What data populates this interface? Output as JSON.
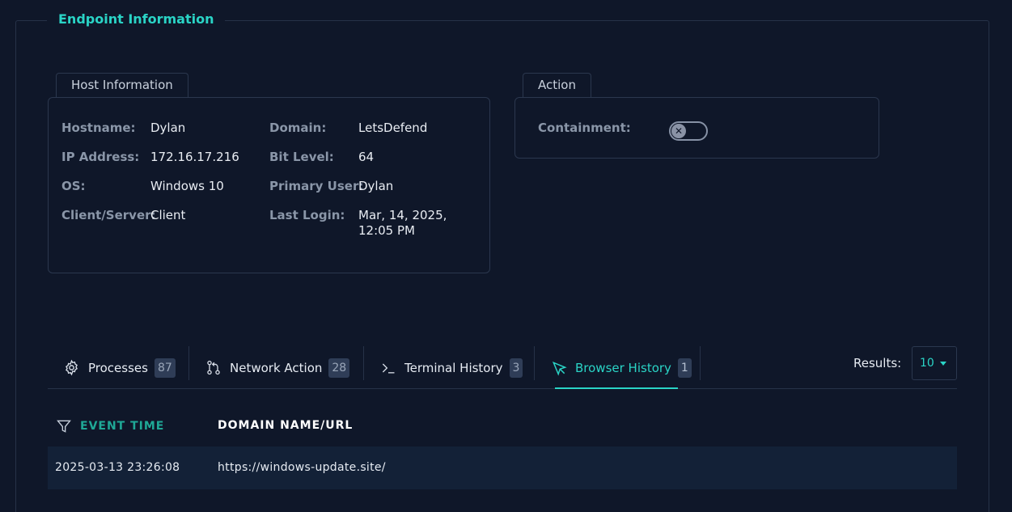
{
  "section": {
    "title": "Endpoint Information"
  },
  "host_panel": {
    "tab_label": "Host Information",
    "fields": [
      {
        "key": "Hostname:",
        "value": "Dylan"
      },
      {
        "key": "IP Address:",
        "value": "172.16.17.216"
      },
      {
        "key": "OS:",
        "value": "Windows 10"
      },
      {
        "key": "Client/Server:",
        "value": "Client"
      },
      {
        "key": "Domain:",
        "value": "LetsDefend"
      },
      {
        "key": "Bit Level:",
        "value": "64"
      },
      {
        "key": "Primary User:",
        "value": "Dylan"
      },
      {
        "key": "Last Login:",
        "value": "Mar, 14, 2025, 12:05 PM"
      }
    ]
  },
  "action_panel": {
    "tab_label": "Action",
    "containment_label": "Containment:",
    "containment_enabled": false,
    "knob_glyph": "✕"
  },
  "tabs": [
    {
      "label": "Processes",
      "count": "87",
      "icon": "gear-icon",
      "active": false
    },
    {
      "label": "Network Action",
      "count": "28",
      "icon": "network-icon",
      "active": false
    },
    {
      "label": "Terminal History",
      "count": "3",
      "icon": "terminal-icon",
      "active": false
    },
    {
      "label": "Browser History",
      "count": "1",
      "icon": "cursor-icon",
      "active": true
    }
  ],
  "results": {
    "label": "Results:",
    "value": "10"
  },
  "table": {
    "columns": [
      "EVENT TIME",
      "DOMAIN NAME/URL"
    ],
    "rows": [
      {
        "event_time": "2025-03-13 23:26:08",
        "url": "https://windows-update.site/"
      }
    ]
  },
  "colors": {
    "accent": "#2ad4c6",
    "background": "#0f1729",
    "border": "#263248"
  }
}
